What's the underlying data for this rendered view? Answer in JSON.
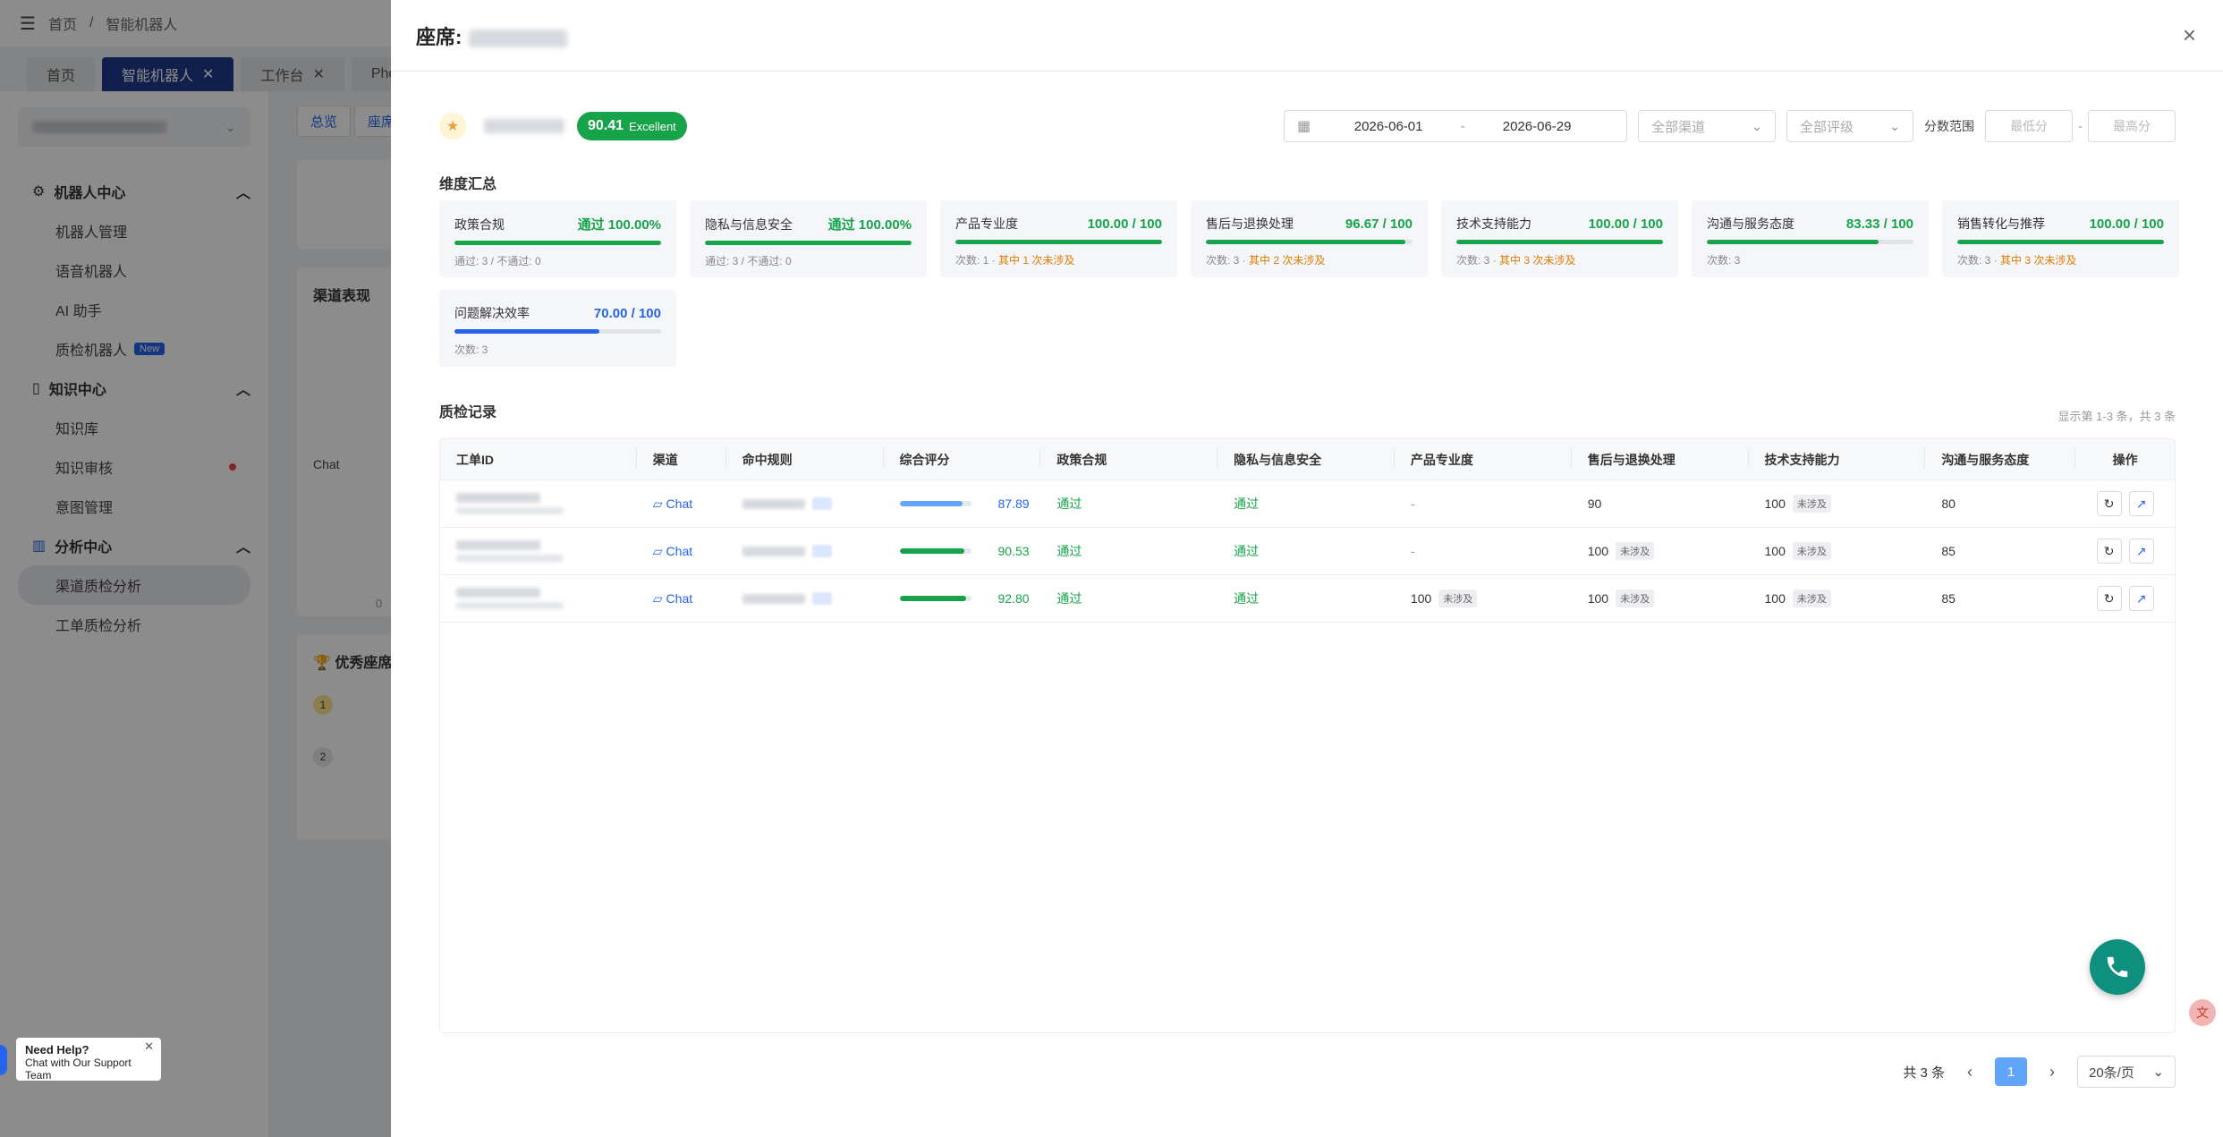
{
  "bg": {
    "breadcrumb": [
      "首页",
      "/",
      "智能机器人"
    ],
    "tabs": [
      {
        "label": "首页",
        "active": false,
        "closable": false
      },
      {
        "label": "智能机器人",
        "active": true,
        "closable": true
      },
      {
        "label": "工作台",
        "active": false,
        "closable": true
      },
      {
        "label": "Phone",
        "active": false,
        "closable": false
      }
    ],
    "sidebar": {
      "groups": [
        {
          "label": "机器人中心",
          "icon": "robot-icon",
          "items": [
            {
              "label": "机器人管理"
            },
            {
              "label": "语音机器人"
            },
            {
              "label": "AI 助手"
            },
            {
              "label": "质检机器人",
              "badge": "New"
            }
          ]
        },
        {
          "label": "知识中心",
          "icon": "book-icon",
          "items": [
            {
              "label": "知识库"
            },
            {
              "label": "知识审核",
              "dot": true
            },
            {
              "label": "意图管理"
            }
          ]
        },
        {
          "label": "分析中心",
          "icon": "chart-icon",
          "items": [
            {
              "label": "渠道质检分析",
              "active": true
            },
            {
              "label": "工单质检分析"
            }
          ]
        }
      ]
    },
    "main": {
      "seg": [
        "总览",
        "座席"
      ],
      "channel_title": "渠道表现",
      "chat_label": "Chat",
      "zero_label": "0",
      "top_agents_title": "优秀座席",
      "rank1": "1",
      "rank2": "2"
    }
  },
  "help": {
    "title": "Need Help?",
    "subtitle": "Chat with Our Support Team",
    "close": "✕"
  },
  "drawer": {
    "title_prefix": "座席:",
    "close": "×",
    "agent": {
      "score": "90.41",
      "grade": "Excellent"
    },
    "filters": {
      "date_start": "2026-06-01",
      "date_sep": "-",
      "date_end": "2026-06-29",
      "channel_placeholder": "全部渠道",
      "rating_placeholder": "全部评级",
      "score_range_label": "分数范围",
      "min_placeholder": "最低分",
      "range_sep": "-",
      "max_placeholder": "最高分"
    },
    "dim_section_title": "维度汇总",
    "dimensions": [
      {
        "name": "政策合规",
        "score_text": "通过 100.00%",
        "fill": 1.0,
        "color": "green",
        "sub": "通过: 3 / 不通过: 0",
        "sub_extra": ""
      },
      {
        "name": "隐私与信息安全",
        "score_text": "通过 100.00%",
        "fill": 1.0,
        "color": "green",
        "sub": "通过: 3 / 不通过: 0",
        "sub_extra": ""
      },
      {
        "name": "产品专业度",
        "score_text": "100.00 / 100",
        "fill": 1.0,
        "color": "green",
        "sub": "次数: 1 · ",
        "sub_extra": "其中 1 次未涉及"
      },
      {
        "name": "售后与退换处理",
        "score_text": "96.67 / 100",
        "fill": 0.9667,
        "color": "green",
        "sub": "次数: 3 · ",
        "sub_extra": "其中 2 次未涉及"
      },
      {
        "name": "技术支持能力",
        "score_text": "100.00 / 100",
        "fill": 1.0,
        "color": "green",
        "sub": "次数: 3 · ",
        "sub_extra": "其中 3 次未涉及"
      },
      {
        "name": "沟通与服务态度",
        "score_text": "83.33 / 100",
        "fill": 0.8333,
        "color": "green",
        "sub": "次数: 3",
        "sub_extra": ""
      },
      {
        "name": "销售转化与推荐",
        "score_text": "100.00 / 100",
        "fill": 1.0,
        "color": "green",
        "sub": "次数: 3 · ",
        "sub_extra": "其中 3 次未涉及"
      },
      {
        "name": "问题解决效率",
        "score_text": "70.00 / 100",
        "fill": 0.7,
        "color": "blue",
        "sub": "次数: 3",
        "sub_extra": ""
      }
    ],
    "records_title": "质检记录",
    "records_meta": "显示第 1-3 条，共 3 条",
    "columns": [
      "工单ID",
      "渠道",
      "命中规则",
      "综合评分",
      "政策合规",
      "隐私与信息安全",
      "产品专业度",
      "售后与退换处理",
      "技术支持能力",
      "沟通与服务态度",
      "操作"
    ],
    "rows": [
      {
        "channel": "Chat",
        "overall": "87.89",
        "overall_fill": 0.8789,
        "bar_color": "#60a5fa",
        "num_color": "b",
        "policy": "通过",
        "privacy": "通过",
        "product": "-",
        "product_tag": "",
        "aftersale": "90",
        "aftersale_tag": "",
        "tech": "100",
        "tech_tag": "未涉及",
        "comm": "80"
      },
      {
        "channel": "Chat",
        "overall": "90.53",
        "overall_fill": 0.9053,
        "bar_color": "#16a34a",
        "num_color": "g",
        "policy": "通过",
        "privacy": "通过",
        "product": "-",
        "product_tag": "",
        "aftersale": "100",
        "aftersale_tag": "未涉及",
        "tech": "100",
        "tech_tag": "未涉及",
        "comm": "85"
      },
      {
        "channel": "Chat",
        "overall": "92.80",
        "overall_fill": 0.928,
        "bar_color": "#16a34a",
        "num_color": "g",
        "policy": "通过",
        "privacy": "通过",
        "product": "100",
        "product_tag": "未涉及",
        "aftersale": "100",
        "aftersale_tag": "未涉及",
        "tech": "100",
        "tech_tag": "未涉及",
        "comm": "85"
      }
    ],
    "pager": {
      "total_text": "共 3 条",
      "current": "1",
      "page_size": "20条/页",
      "prev": "‹",
      "next": "›"
    }
  },
  "colors": {
    "accent": "#2563eb",
    "success": "#16a34a",
    "warning": "#e07b00",
    "fab": "#0f8f7e"
  }
}
